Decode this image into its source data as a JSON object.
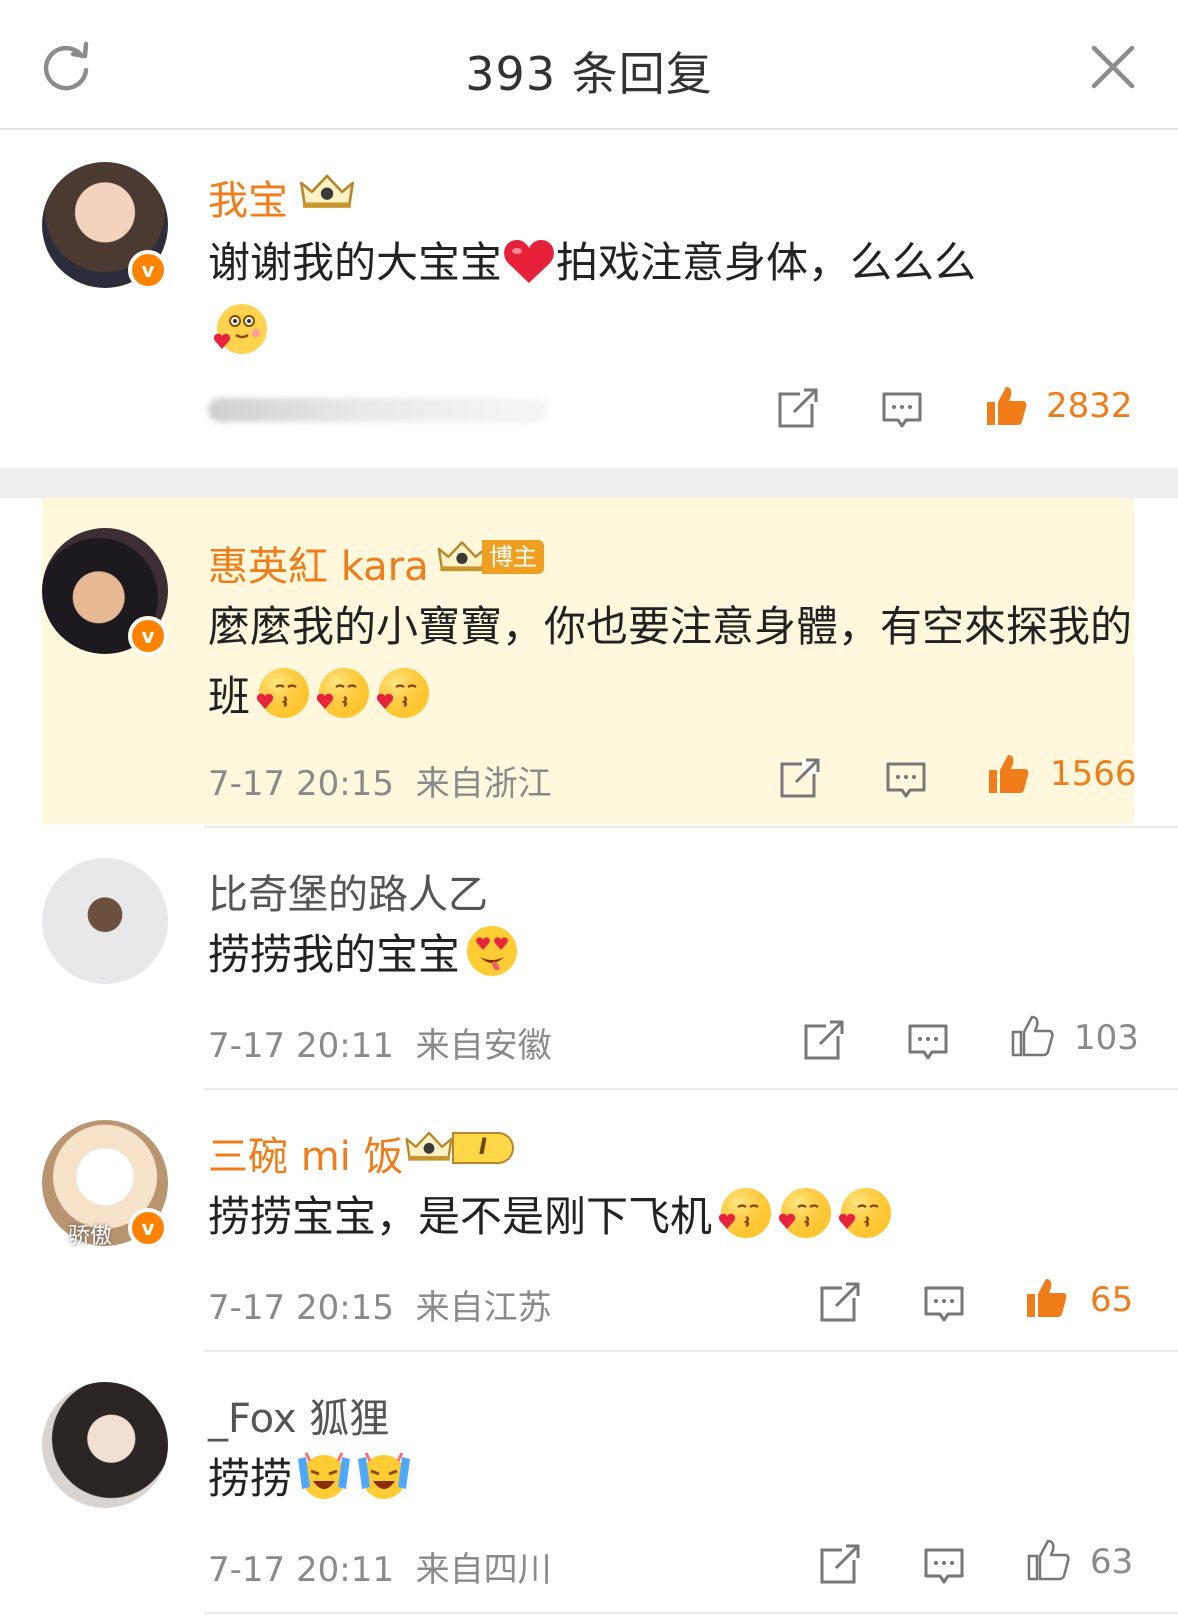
{
  "header": {
    "title": "393 条回复"
  },
  "comments": [
    {
      "name": "我宝",
      "text": "谢谢我的大宝宝",
      "text_after": "拍戏注意身体，么么么",
      "likes": "2832",
      "liked": true
    },
    {
      "name": "惠英紅 kara",
      "badge": "博主",
      "text": "麼麼我的小寶寶，你也要注意身體，有空來探我的班",
      "time": "7-17 20:15",
      "location": "来自浙江",
      "likes": "1566",
      "liked": true
    },
    {
      "name": "比奇堡的路人乙",
      "text": "捞捞我的宝宝",
      "time": "7-17 20:11",
      "location": "来自安徽",
      "likes": "103",
      "liked": false
    },
    {
      "name": "三碗 mi 饭",
      "level": "I",
      "avatar_caption": "骄傲",
      "text": "捞捞宝宝，是不是刚下飞机",
      "time": "7-17 20:15",
      "location": "来自江苏",
      "likes": "65",
      "liked": true
    },
    {
      "name": "_Fox 狐狸",
      "text": "捞捞",
      "time": "7-17 20:11",
      "location": "来自四川",
      "likes": "63",
      "liked": false
    }
  ],
  "colors": {
    "accent": "#f07d1a",
    "highlight": "#fff8dc",
    "verified": "#ff8200"
  },
  "icons": [
    "refresh-icon",
    "close-icon",
    "share-icon",
    "comment-icon",
    "like-icon",
    "verified-icon",
    "crown-icon",
    "heart-icon",
    "kiss-emoji-icon",
    "heart-eyes-emoji-icon",
    "crying-laughing-emoji-icon"
  ]
}
